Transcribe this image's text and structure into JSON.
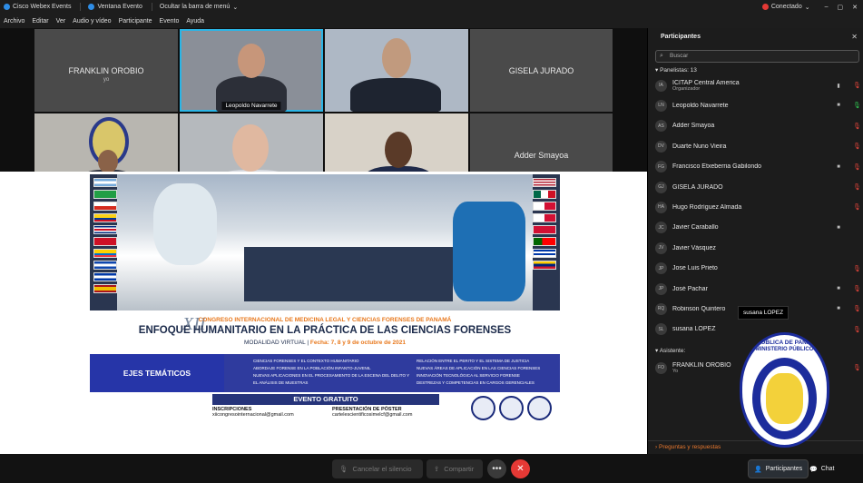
{
  "titlebar": {
    "app": "Cisco Webex Events",
    "window": "Ventana Evento",
    "hide_menu": "Ocultar la barra de menú",
    "status": "Conectado"
  },
  "menu": [
    "Archivo",
    "Editar",
    "Ver",
    "Audio y vídeo",
    "Participante",
    "Evento",
    "Ayuda"
  ],
  "video": {
    "tiles": [
      {
        "name": "FRANKLIN OROBIO",
        "sub": "yo"
      },
      {
        "name": "Leopoldo Navarrete"
      },
      {
        "name": ""
      },
      {
        "name": "GISELA JURADO"
      },
      {
        "name": ""
      },
      {
        "name": ""
      },
      {
        "name": ""
      },
      {
        "name": "Adder Smayoa"
      }
    ]
  },
  "poster": {
    "roman": "XII",
    "line1": "CONGRESO INTERNACIONAL DE MEDICINA LEGAL Y CIENCIAS FORENSES DE PANAMÁ",
    "line2": "ENFOQUE HUMANITARIO EN LA PRÁCTICA DE LAS CIENCIAS FORENSES",
    "mode": "MODALIDAD VIRTUAL",
    "dates": "Fecha: 7, 8 y 9 de octubre de 2021",
    "ejes": "EJES TEMÁTICOS",
    "topics_left": [
      "CIENCIAS FORENSES Y EL CONTEXTO HUMANITARIO",
      "ABORDAJE FORENSE EN LA POBLACIÓN INFANTO-JUVENIL",
      "NUEVAS APLICACIONES EN EL PROCESAMIENTO DE LA ESCENA DEL DELITO Y EL ANÁLISIS DE MUESTRAS"
    ],
    "topics_right": [
      "RELACIÓN ENTRE EL PERITO Y EL SISTEMA DE JUSTICIA",
      "NUEVAS ÁREAS DE APLICACIÓN EN LAS CIENCIAS FORENSES",
      "INNOVACIÓN TECNOLÓGICA AL SERVICIO FORENSE",
      "DESTREZAS Y COMPETENCIAS EN CARGOS GERENCIALES"
    ],
    "free": "EVENTO GRATUITO",
    "insc_label": "INSCRIPCIONES",
    "insc_mail": "xiicongresointernacional@gmail.com",
    "poster_label": "PRESENTACIÓN DE PÓSTER",
    "poster_mail": "cartelescientificosimelcf@gmail.com"
  },
  "panel": {
    "title": "Participantes",
    "search_placeholder": "Buscar",
    "panelists_label": "Panelistas: 13",
    "attendee_label": "Asistente:",
    "qa": "Preguntas y respuestas",
    "tooltip": "susana LOPEZ",
    "panelists": [
      {
        "initials": "IA",
        "name": "ICITAP Central America",
        "role": "Organizador",
        "mic": "muted",
        "cam": "bars"
      },
      {
        "initials": "LN",
        "name": "Leopoldo Navarrete",
        "role": "",
        "mic": "on",
        "cam": "cam"
      },
      {
        "initials": "AS",
        "name": "Adder Smayoa",
        "role": "",
        "mic": "muted",
        "cam": ""
      },
      {
        "initials": "DV",
        "name": "Duarte Nuno Vieira",
        "role": "",
        "mic": "muted",
        "cam": ""
      },
      {
        "initials": "FG",
        "name": "Francisco Etxeberria Gabilondo",
        "role": "",
        "mic": "muted",
        "cam": "cam"
      },
      {
        "initials": "GJ",
        "name": "GISELA JURADO",
        "role": "",
        "mic": "muted",
        "cam": ""
      },
      {
        "initials": "HA",
        "name": "Hugo Rodríguez Almada",
        "role": "",
        "mic": "muted",
        "cam": ""
      },
      {
        "initials": "JC",
        "name": "Javier Caraballo",
        "role": "",
        "mic": "",
        "cam": "cam"
      },
      {
        "initials": "JV",
        "name": "Javier Vásquez",
        "role": "",
        "mic": "",
        "cam": ""
      },
      {
        "initials": "JP",
        "name": "Jose Luis Prieto",
        "role": "",
        "mic": "muted",
        "cam": ""
      },
      {
        "initials": "JP",
        "name": "José Pachar",
        "role": "",
        "mic": "muted",
        "cam": "cam"
      },
      {
        "initials": "RQ",
        "name": "Robinson Quintero",
        "role": "",
        "mic": "muted",
        "cam": "cam"
      },
      {
        "initials": "SL",
        "name": "susana LOPEZ",
        "role": "",
        "mic": "muted",
        "cam": ""
      }
    ],
    "attendees": [
      {
        "initials": "FO",
        "name": "FRANKLIN OROBIO",
        "role": "Yo",
        "mic": "muted",
        "cam": ""
      }
    ]
  },
  "seal": {
    "line1": "REPÚBLICA DE PANAMÁ",
    "line2": "MINISTERIO PÚBLICO",
    "ring": "INSTITUTO DE MEDICINA LEGAL Y CIENCIAS FORENSES"
  },
  "controls": {
    "mute": "Cancelar el silencio",
    "share": "Compartir",
    "participants": "Participantes",
    "chat": "Chat"
  },
  "colors": {
    "accent": "#2bb5e6",
    "end_call": "#e53935",
    "muted": "#e0443a",
    "on": "#2fbf4f",
    "qa": "#e8782e"
  }
}
